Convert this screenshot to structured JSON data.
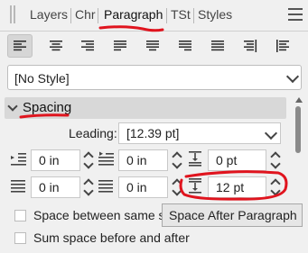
{
  "tabs": [
    "Layers",
    "Chr",
    "Paragraph",
    "TSt",
    "Styles"
  ],
  "active_tab": "Paragraph",
  "alignment_buttons": [
    {
      "name": "align-left-icon",
      "selected": true
    },
    {
      "name": "align-center-icon",
      "selected": false
    },
    {
      "name": "align-right-icon",
      "selected": false
    },
    {
      "name": "justify-left-icon",
      "selected": false
    },
    {
      "name": "justify-center-icon",
      "selected": false
    },
    {
      "name": "justify-right-icon",
      "selected": false
    },
    {
      "name": "justify-all-icon",
      "selected": false
    },
    {
      "name": "align-towards-spine-icon",
      "selected": false
    },
    {
      "name": "align-away-from-spine-icon",
      "selected": false
    }
  ],
  "paragraph_style": "[No Style]",
  "section": {
    "title": "Spacing",
    "expanded": true
  },
  "leading": {
    "label": "Leading:",
    "value": "[12.39 pt]"
  },
  "indent_left": "0 in",
  "indent_first_line": "0 in",
  "space_before": "0 pt",
  "indent_right": "0 in",
  "indent_last_line": "0 in",
  "space_after": "12 pt",
  "checkbox_1_label": "Space between same st",
  "checkbox_2_label": "Sum space before and after",
  "tooltip": "Space After Paragraph",
  "annotation_color": "#e0141e"
}
